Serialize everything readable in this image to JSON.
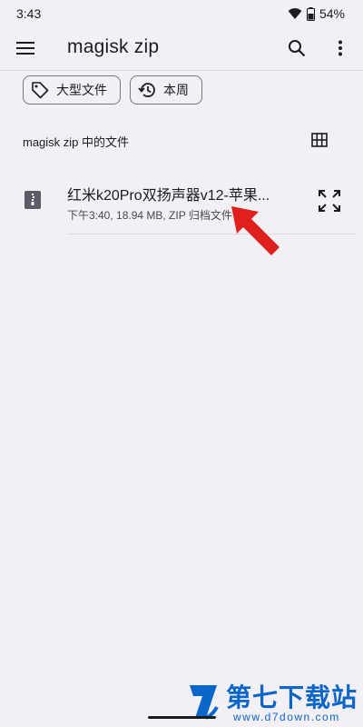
{
  "status_bar": {
    "time": "3:43",
    "battery": "54%"
  },
  "app_bar": {
    "title": "magisk zip",
    "menu_icon": "menu-icon",
    "search_icon": "search-icon",
    "more_icon": "more-vert-icon"
  },
  "filters": [
    {
      "label": "大型文件",
      "icon": "tag-icon"
    },
    {
      "label": "本周",
      "icon": "history-icon"
    }
  ],
  "section": {
    "label": "magisk zip 中的文件",
    "view_icon": "grid-view-icon"
  },
  "files": [
    {
      "name": "红米k20Pro双扬声器v12-苹果...",
      "meta": "下午3:40, 18.94 MB, ZIP 归档文件",
      "icon": "zip-file-icon",
      "action_icon": "expand-icon"
    }
  ],
  "watermark": {
    "title": "第七下载站",
    "url": "www.d7down.com"
  },
  "colors": {
    "background": "#f3f0f5",
    "arrow": "#e0201c",
    "watermark": "#0a66c8"
  }
}
